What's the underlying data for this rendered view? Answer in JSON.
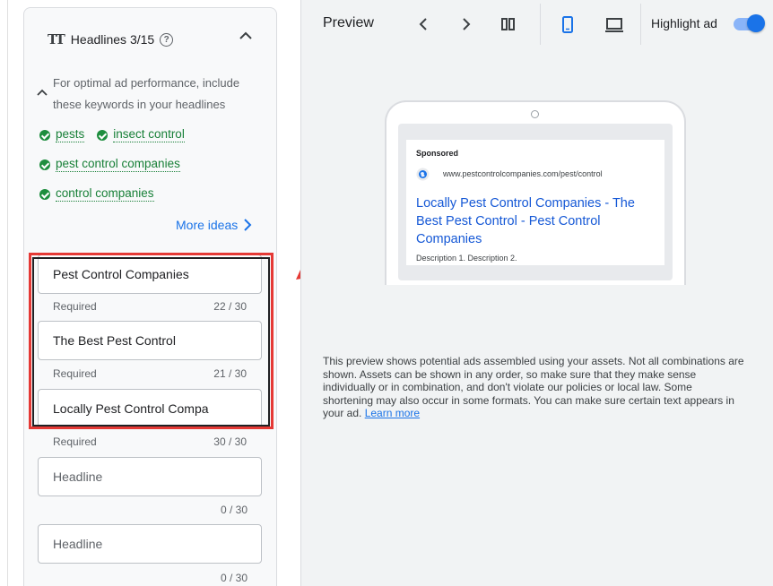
{
  "headlines": {
    "title": "Headlines 3/15",
    "tip": "For optimal ad performance, include these keywords in your headlines",
    "keywords": [
      "pests",
      "insect control",
      "pest control companies",
      "control companies"
    ],
    "more_ideas": "More ideas",
    "fields": [
      {
        "value": "Pest Control Companies",
        "helper": "Required",
        "count": "22 / 30"
      },
      {
        "value": "The Best Pest Control",
        "helper": "Required",
        "count": "21 / 30"
      },
      {
        "value": "Locally Pest Control Compa",
        "helper": "Required",
        "count": "30 / 30"
      },
      {
        "placeholder": "Headline",
        "count": "0 / 30"
      },
      {
        "placeholder": "Headline",
        "count": "0 / 30"
      }
    ]
  },
  "preview": {
    "title": "Preview",
    "highlight_label": "Highlight ad",
    "highlight_on": true,
    "device_selected": "mobile"
  },
  "ad": {
    "sponsored": "Sponsored",
    "url": "www.pestcontrolcompanies.com/pest/control",
    "headline": "Locally Pest Control Companies - The Best Pest Control - Pest Control Companies",
    "description": "Description 1. Description 2."
  },
  "disclaimer": {
    "text": "This preview shows potential ads assembled using your assets. Not all combinations are shown. Assets can be shown in any order, so make sure that they make sense individually or in combination, and don't violate our policies or local law. Some shortening may also occur in some formats. You can make sure certain text appears in your ad.",
    "link": "Learn more"
  },
  "colors": {
    "accent": "#1a73e8",
    "keyword_green": "#188038",
    "annotation_red": "#e53935"
  }
}
